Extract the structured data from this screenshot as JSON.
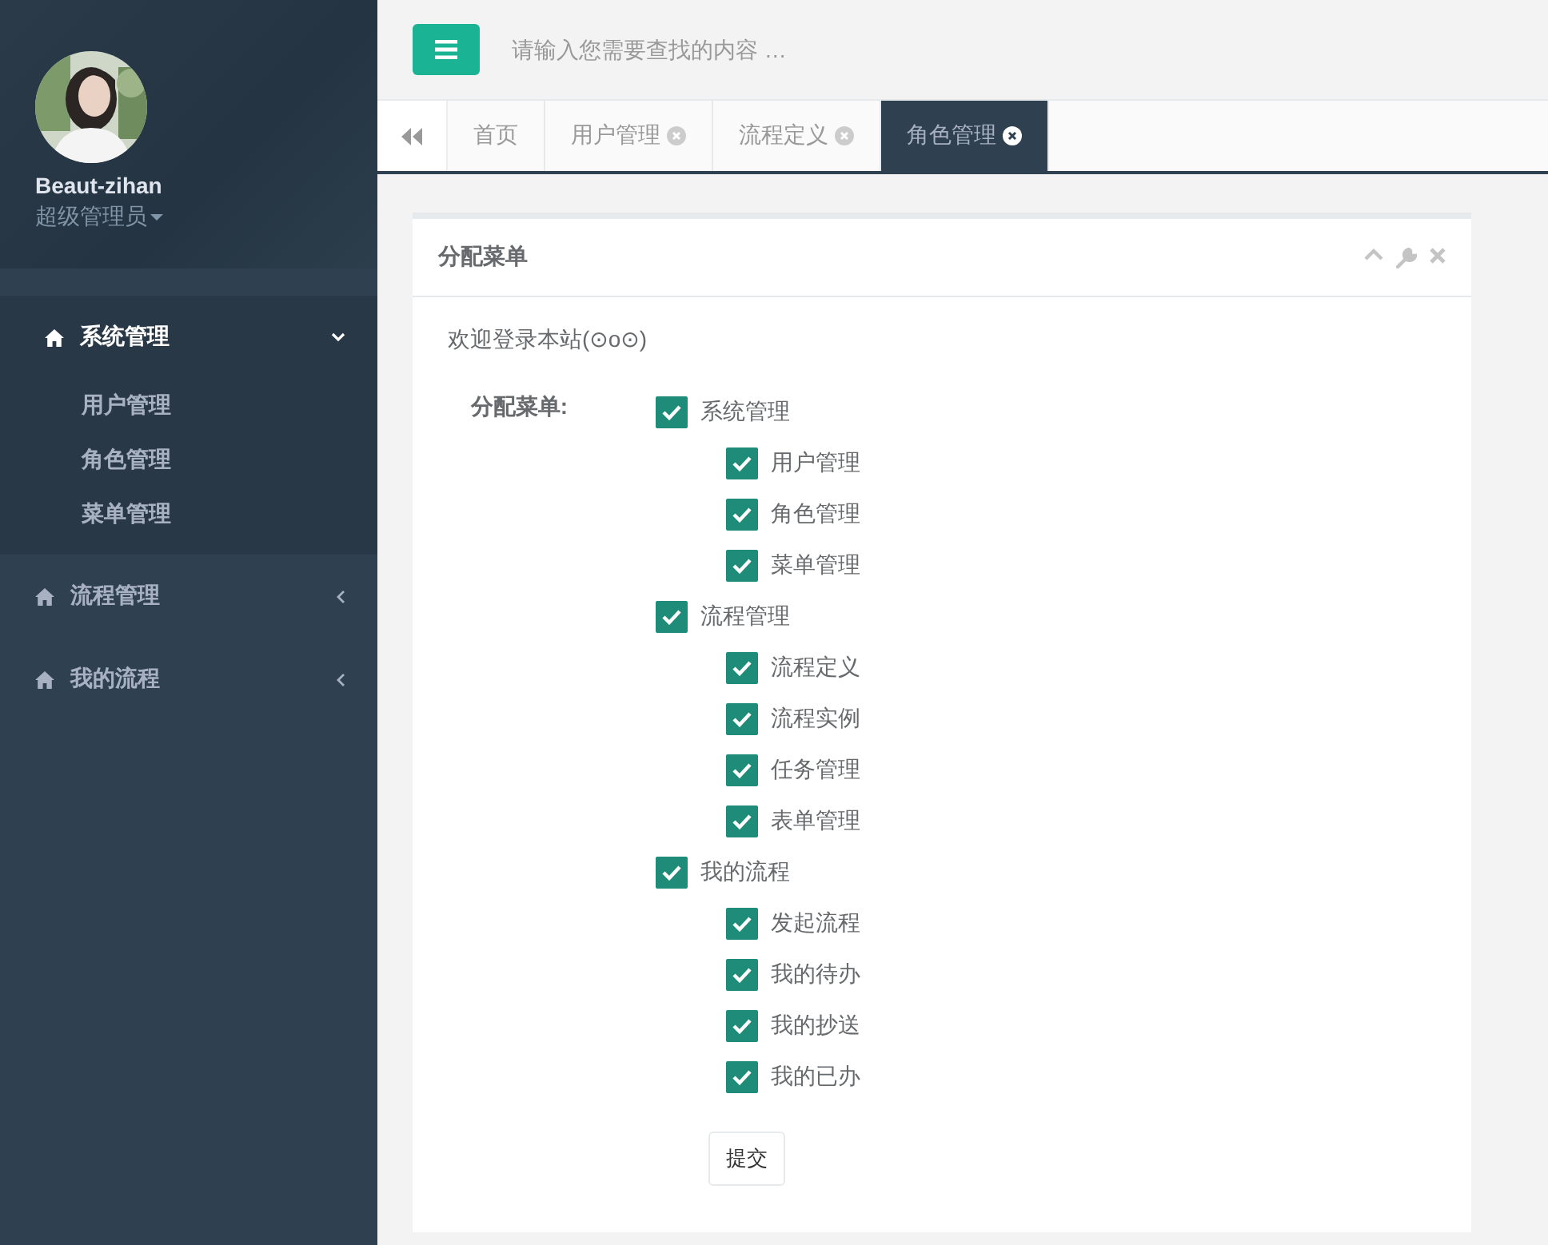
{
  "sidebar": {
    "user": {
      "name": "Beaut-zihan",
      "role": "超级管理员"
    },
    "menu": [
      {
        "label": "系统管理",
        "expanded": true,
        "children": [
          {
            "label": "用户管理"
          },
          {
            "label": "角色管理"
          },
          {
            "label": "菜单管理"
          }
        ]
      },
      {
        "label": "流程管理",
        "expanded": false
      },
      {
        "label": "我的流程",
        "expanded": false
      }
    ]
  },
  "search": {
    "placeholder": "请输入您需要查找的内容 …"
  },
  "tabs": [
    {
      "label": "首页",
      "selected": false,
      "closable": false
    },
    {
      "label": "用户管理",
      "selected": false,
      "closable": true
    },
    {
      "label": "流程定义",
      "selected": false,
      "closable": true
    },
    {
      "label": "角色管理",
      "selected": true,
      "closable": true
    }
  ],
  "panel": {
    "title": "分配菜单",
    "welcome": "欢迎登录本站(⊙o⊙)",
    "field_label": "分配菜单:",
    "tree": [
      {
        "label": "系统管理",
        "checked": true,
        "children": [
          {
            "label": "用户管理",
            "checked": true
          },
          {
            "label": "角色管理",
            "checked": true
          },
          {
            "label": "菜单管理",
            "checked": true
          }
        ]
      },
      {
        "label": "流程管理",
        "checked": true,
        "children": [
          {
            "label": "流程定义",
            "checked": true
          },
          {
            "label": "流程实例",
            "checked": true
          },
          {
            "label": "任务管理",
            "checked": true
          },
          {
            "label": "表单管理",
            "checked": true
          }
        ]
      },
      {
        "label": "我的流程",
        "checked": true,
        "children": [
          {
            "label": "发起流程",
            "checked": true
          },
          {
            "label": "我的待办",
            "checked": true
          },
          {
            "label": "我的抄送",
            "checked": true
          },
          {
            "label": "我的已办",
            "checked": true
          }
        ]
      }
    ],
    "submit": "提交"
  }
}
